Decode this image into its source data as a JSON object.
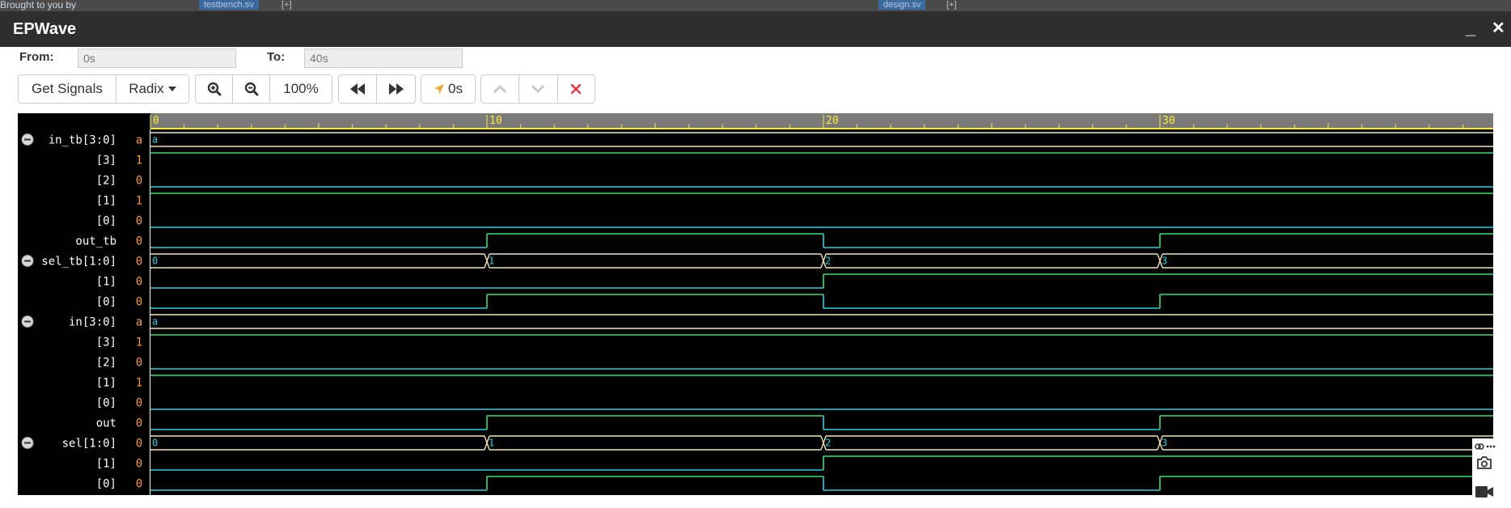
{
  "background": {
    "left_text": "Brought to you by",
    "tab1": "testbench.sv",
    "tab2": "design.sv",
    "tab_plus": "[+]"
  },
  "window": {
    "title": "EPWave",
    "minimize_label": "_",
    "close_label": "✕"
  },
  "range": {
    "from_label": "From:",
    "from_value": "0s",
    "to_label": "To:",
    "to_value": "40s"
  },
  "toolbar": {
    "get_signals": "Get Signals",
    "radix": "Radix",
    "zoom_level": "100%",
    "cursor_time": "0s"
  },
  "colors": {
    "ruler_bg": "#7a7a7a",
    "ruler_line": "#ffee33",
    "signal_name": "#ffffff",
    "signal_value": "#ff9933",
    "wave_green": "#2fe36a",
    "wave_cyan": "#22d3e6",
    "bus_line": "#f0e6b4",
    "cancel_red": "#e63946"
  },
  "waveform": {
    "time_range": [
      0,
      40
    ],
    "ruler_ticks": [
      "0",
      "10",
      "20",
      "30"
    ],
    "signals": [
      {
        "name": "in_tb[3:0]",
        "value": "a",
        "type": "bus",
        "collapse": true,
        "segments": [
          {
            "t": 0,
            "label": "a"
          }
        ]
      },
      {
        "name": "[3]",
        "value": "1",
        "type": "bit",
        "transitions": [
          [
            0,
            1
          ]
        ]
      },
      {
        "name": "[2]",
        "value": "0",
        "type": "bit",
        "transitions": [
          [
            0,
            0
          ]
        ]
      },
      {
        "name": "[1]",
        "value": "1",
        "type": "bit",
        "transitions": [
          [
            0,
            1
          ]
        ]
      },
      {
        "name": "[0]",
        "value": "0",
        "type": "bit",
        "transitions": [
          [
            0,
            0
          ]
        ]
      },
      {
        "name": "out_tb",
        "value": "0",
        "type": "bit",
        "transitions": [
          [
            0,
            0
          ],
          [
            10,
            1
          ],
          [
            20,
            0
          ],
          [
            30,
            1
          ]
        ]
      },
      {
        "name": "sel_tb[1:0]",
        "value": "0",
        "type": "bus",
        "collapse": true,
        "segments": [
          {
            "t": 0,
            "label": "0"
          },
          {
            "t": 10,
            "label": "1"
          },
          {
            "t": 20,
            "label": "2"
          },
          {
            "t": 30,
            "label": "3"
          }
        ]
      },
      {
        "name": "[1]",
        "value": "0",
        "type": "bit",
        "transitions": [
          [
            0,
            0
          ],
          [
            20,
            1
          ]
        ]
      },
      {
        "name": "[0]",
        "value": "0",
        "type": "bit",
        "transitions": [
          [
            0,
            0
          ],
          [
            10,
            1
          ],
          [
            20,
            0
          ],
          [
            30,
            1
          ]
        ]
      },
      {
        "name": "in[3:0]",
        "value": "a",
        "type": "bus",
        "collapse": true,
        "segments": [
          {
            "t": 0,
            "label": "a"
          }
        ]
      },
      {
        "name": "[3]",
        "value": "1",
        "type": "bit",
        "transitions": [
          [
            0,
            1
          ]
        ]
      },
      {
        "name": "[2]",
        "value": "0",
        "type": "bit",
        "transitions": [
          [
            0,
            0
          ]
        ]
      },
      {
        "name": "[1]",
        "value": "1",
        "type": "bit",
        "transitions": [
          [
            0,
            1
          ]
        ]
      },
      {
        "name": "[0]",
        "value": "0",
        "type": "bit",
        "transitions": [
          [
            0,
            0
          ]
        ]
      },
      {
        "name": "out",
        "value": "0",
        "type": "bit",
        "transitions": [
          [
            0,
            0
          ],
          [
            10,
            1
          ],
          [
            20,
            0
          ],
          [
            30,
            1
          ]
        ]
      },
      {
        "name": "sel[1:0]",
        "value": "0",
        "type": "bus",
        "collapse": true,
        "segments": [
          {
            "t": 0,
            "label": "0"
          },
          {
            "t": 10,
            "label": "1"
          },
          {
            "t": 20,
            "label": "2"
          },
          {
            "t": 30,
            "label": "3"
          }
        ]
      },
      {
        "name": "[1]",
        "value": "0",
        "type": "bit",
        "transitions": [
          [
            0,
            0
          ],
          [
            20,
            1
          ]
        ]
      },
      {
        "name": "[0]",
        "value": "0",
        "type": "bit",
        "transitions": [
          [
            0,
            0
          ],
          [
            10,
            1
          ],
          [
            20,
            0
          ],
          [
            30,
            1
          ]
        ]
      }
    ]
  },
  "side_tools": {
    "icons": [
      "link-icon",
      "more-icon",
      "camera-icon",
      "video-icon"
    ]
  }
}
